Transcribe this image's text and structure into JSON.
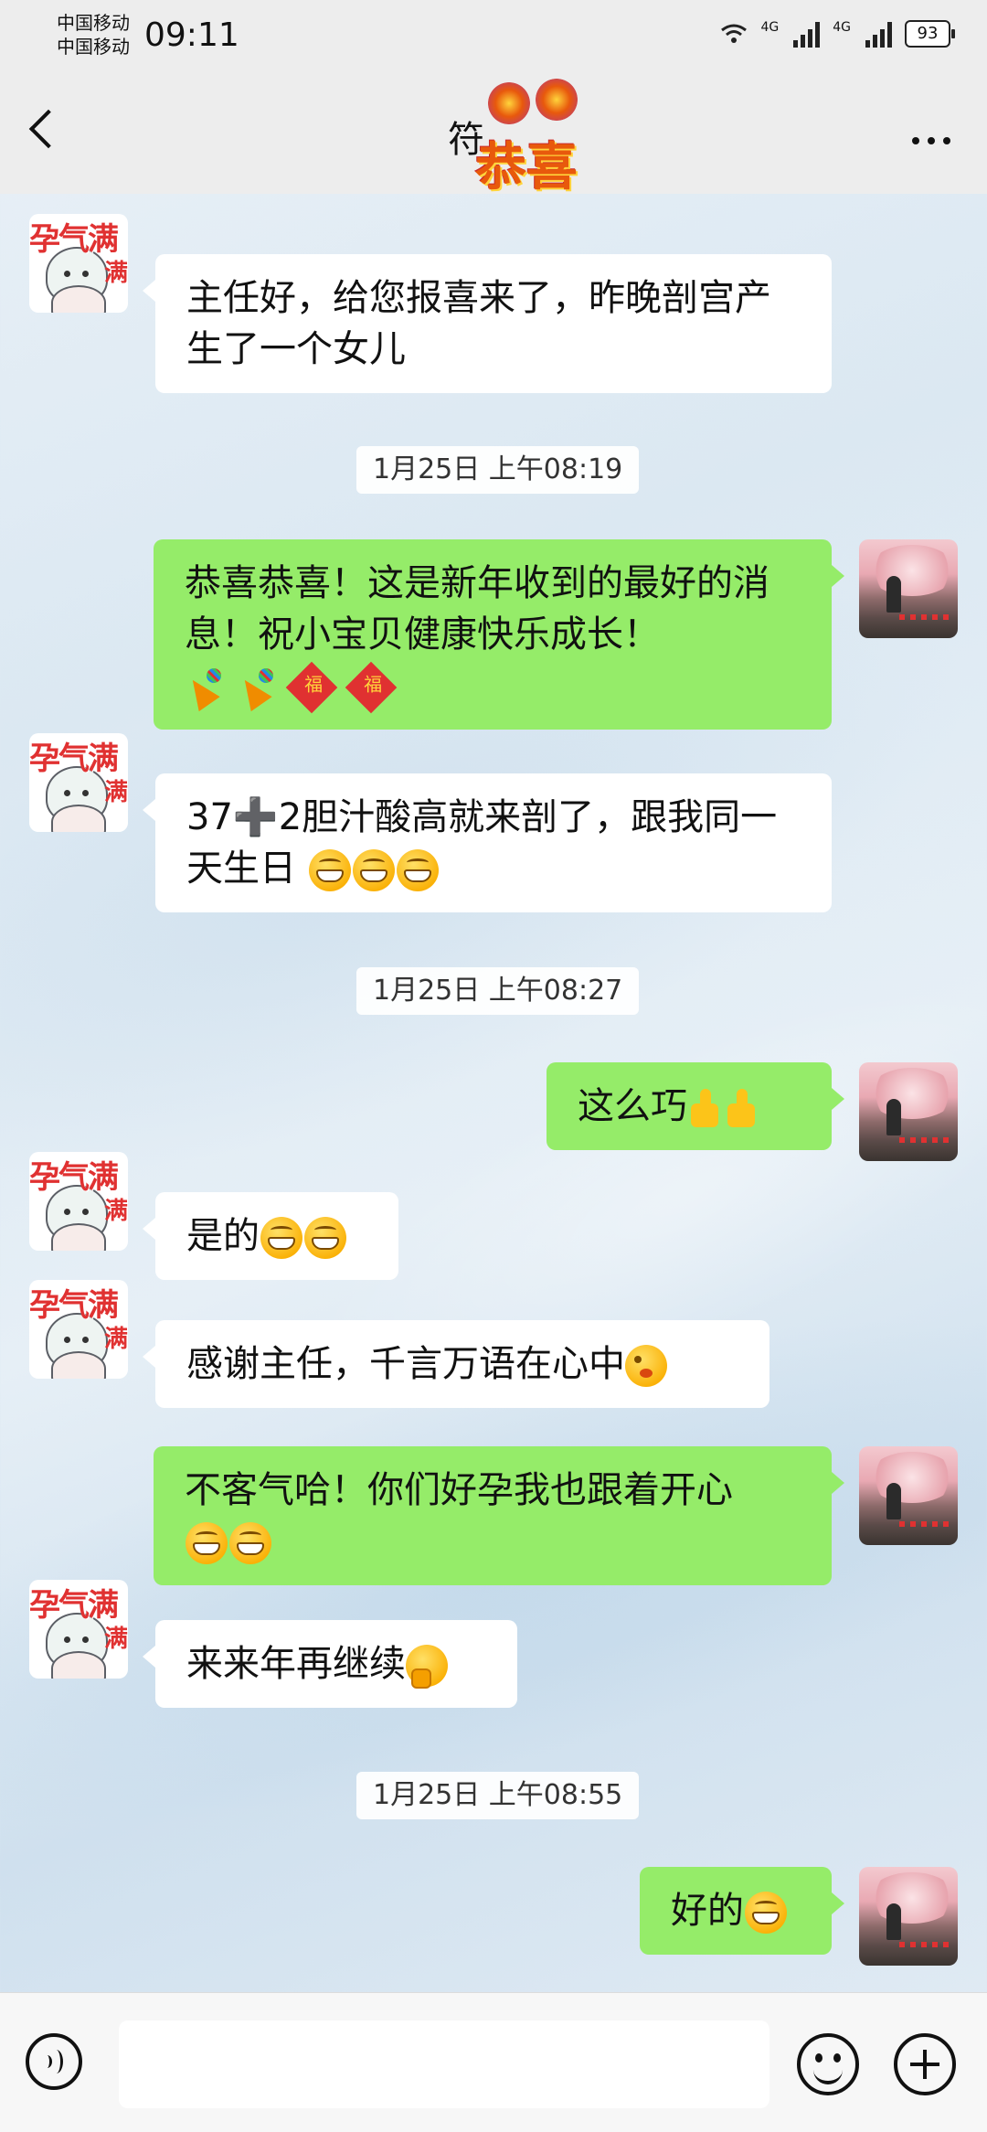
{
  "status_bar": {
    "carrier_1": "中国移动",
    "carrier_2": "中国移动",
    "time": "09:11",
    "network_1": "4G",
    "network_2": "4G",
    "battery": "93"
  },
  "header": {
    "title": "符",
    "title_sticker_text": "恭喜"
  },
  "messages": [
    {
      "side": "left",
      "parts": [
        "主任好，给您报喜来了，昨晚剖宫产生了一个女儿"
      ]
    },
    {
      "type": "timestamp",
      "text": "1月25日 上午08:19"
    },
    {
      "side": "right",
      "text": "恭喜恭喜！这是新年收到的最好的消息！祝小宝贝健康快乐成长！",
      "emojis": [
        "party-popper",
        "party-popper",
        "fu-diamond",
        "fu-diamond"
      ]
    },
    {
      "side": "left",
      "text_a": "37",
      "text_b": "2胆汁酸高就来剖了，跟我同一天生日",
      "emojis": [
        "grin",
        "grin",
        "grin"
      ]
    },
    {
      "type": "timestamp",
      "text": "1月25日 上午08:27"
    },
    {
      "side": "right",
      "text": "这么巧",
      "emojis": [
        "thumbs-up",
        "thumbs-up"
      ]
    },
    {
      "side": "left",
      "text": "是的",
      "emojis": [
        "grin",
        "grin"
      ]
    },
    {
      "side": "left",
      "text": "感谢主任，千言万语在心中",
      "emojis": [
        "wink"
      ]
    },
    {
      "side": "right",
      "text": "不客气哈！你们好孕我也跟着开心",
      "emojis": [
        "grin",
        "grin"
      ]
    },
    {
      "side": "left",
      "text": "来来年再继续",
      "emojis": [
        "thinking"
      ]
    },
    {
      "type": "timestamp",
      "text": "1月25日 上午08:55"
    },
    {
      "side": "right",
      "text": "好的",
      "emojis": [
        "grin"
      ]
    }
  ],
  "contact_avatar": {
    "badge_text": "孕气满",
    "badge_text_2": "满"
  },
  "input": {
    "placeholder": ""
  },
  "colors": {
    "sent_bubble": "#95ec69",
    "received_bubble": "#ffffff",
    "bar_bg": "#ededed"
  }
}
